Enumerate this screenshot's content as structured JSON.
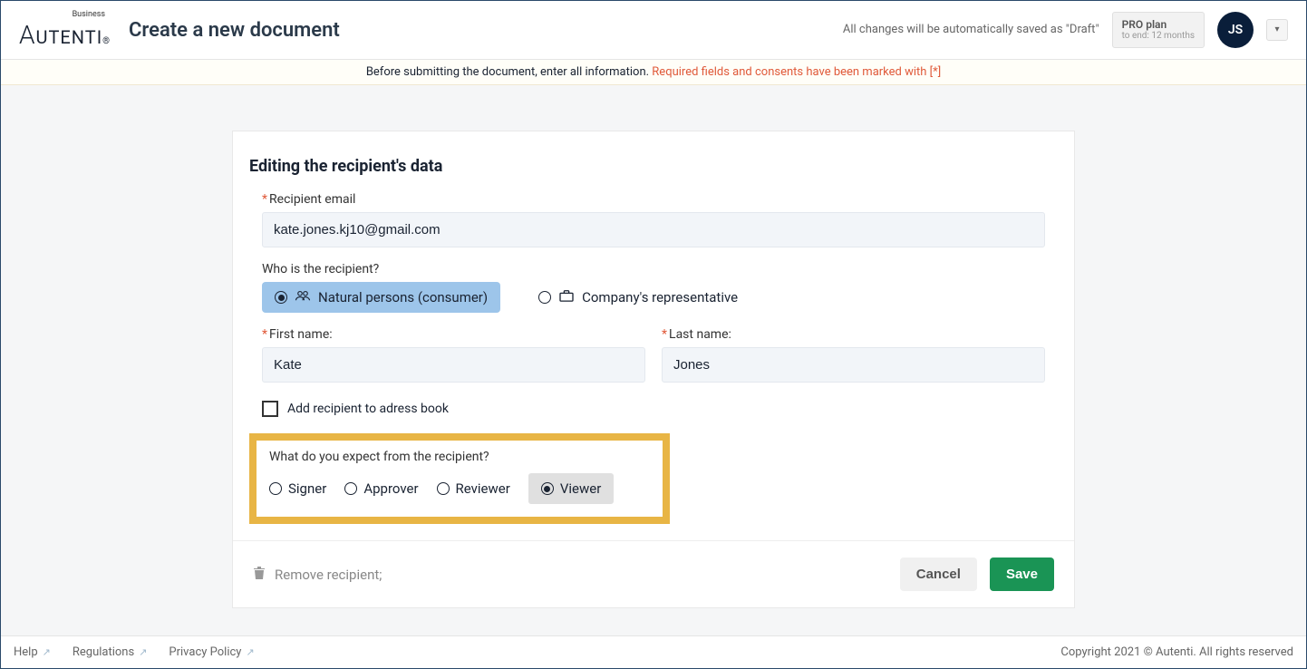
{
  "header": {
    "logo_super": "Business",
    "logo_text": "AUTENTI",
    "page_title": "Create a new document",
    "autosave_msg": "All changes will be automatically saved as \"Draft\"",
    "plan_title": "PRO plan",
    "plan_sub": "to end: 12 months",
    "avatar_initials": "JS"
  },
  "infobar": {
    "text": "Before submitting the document, enter all information. ",
    "required_note": "Required fields and consents have been marked with [*]"
  },
  "card": {
    "title": "Editing the recipient's data",
    "email_label": "Recipient email",
    "email_value": "kate.jones.kj10@gmail.com",
    "who_label": "Who is the recipient?",
    "who_options": {
      "natural": "Natural persons (consumer)",
      "company": "Company's representative"
    },
    "first_name_label": "First name:",
    "first_name_value": "Kate",
    "last_name_label": "Last name:",
    "last_name_value": "Jones",
    "add_book_label": "Add recipient to adress book",
    "expect_label": "What do you expect from the recipient?",
    "roles": {
      "signer": "Signer",
      "approver": "Approver",
      "reviewer": "Reviewer",
      "viewer": "Viewer"
    },
    "remove_label": "Remove recipient;",
    "cancel_label": "Cancel",
    "save_label": "Save"
  },
  "footer": {
    "help": "Help",
    "regulations": "Regulations",
    "privacy": "Privacy Policy",
    "copyright": "Copyright 2021 © Autenti. All rights reserved"
  }
}
